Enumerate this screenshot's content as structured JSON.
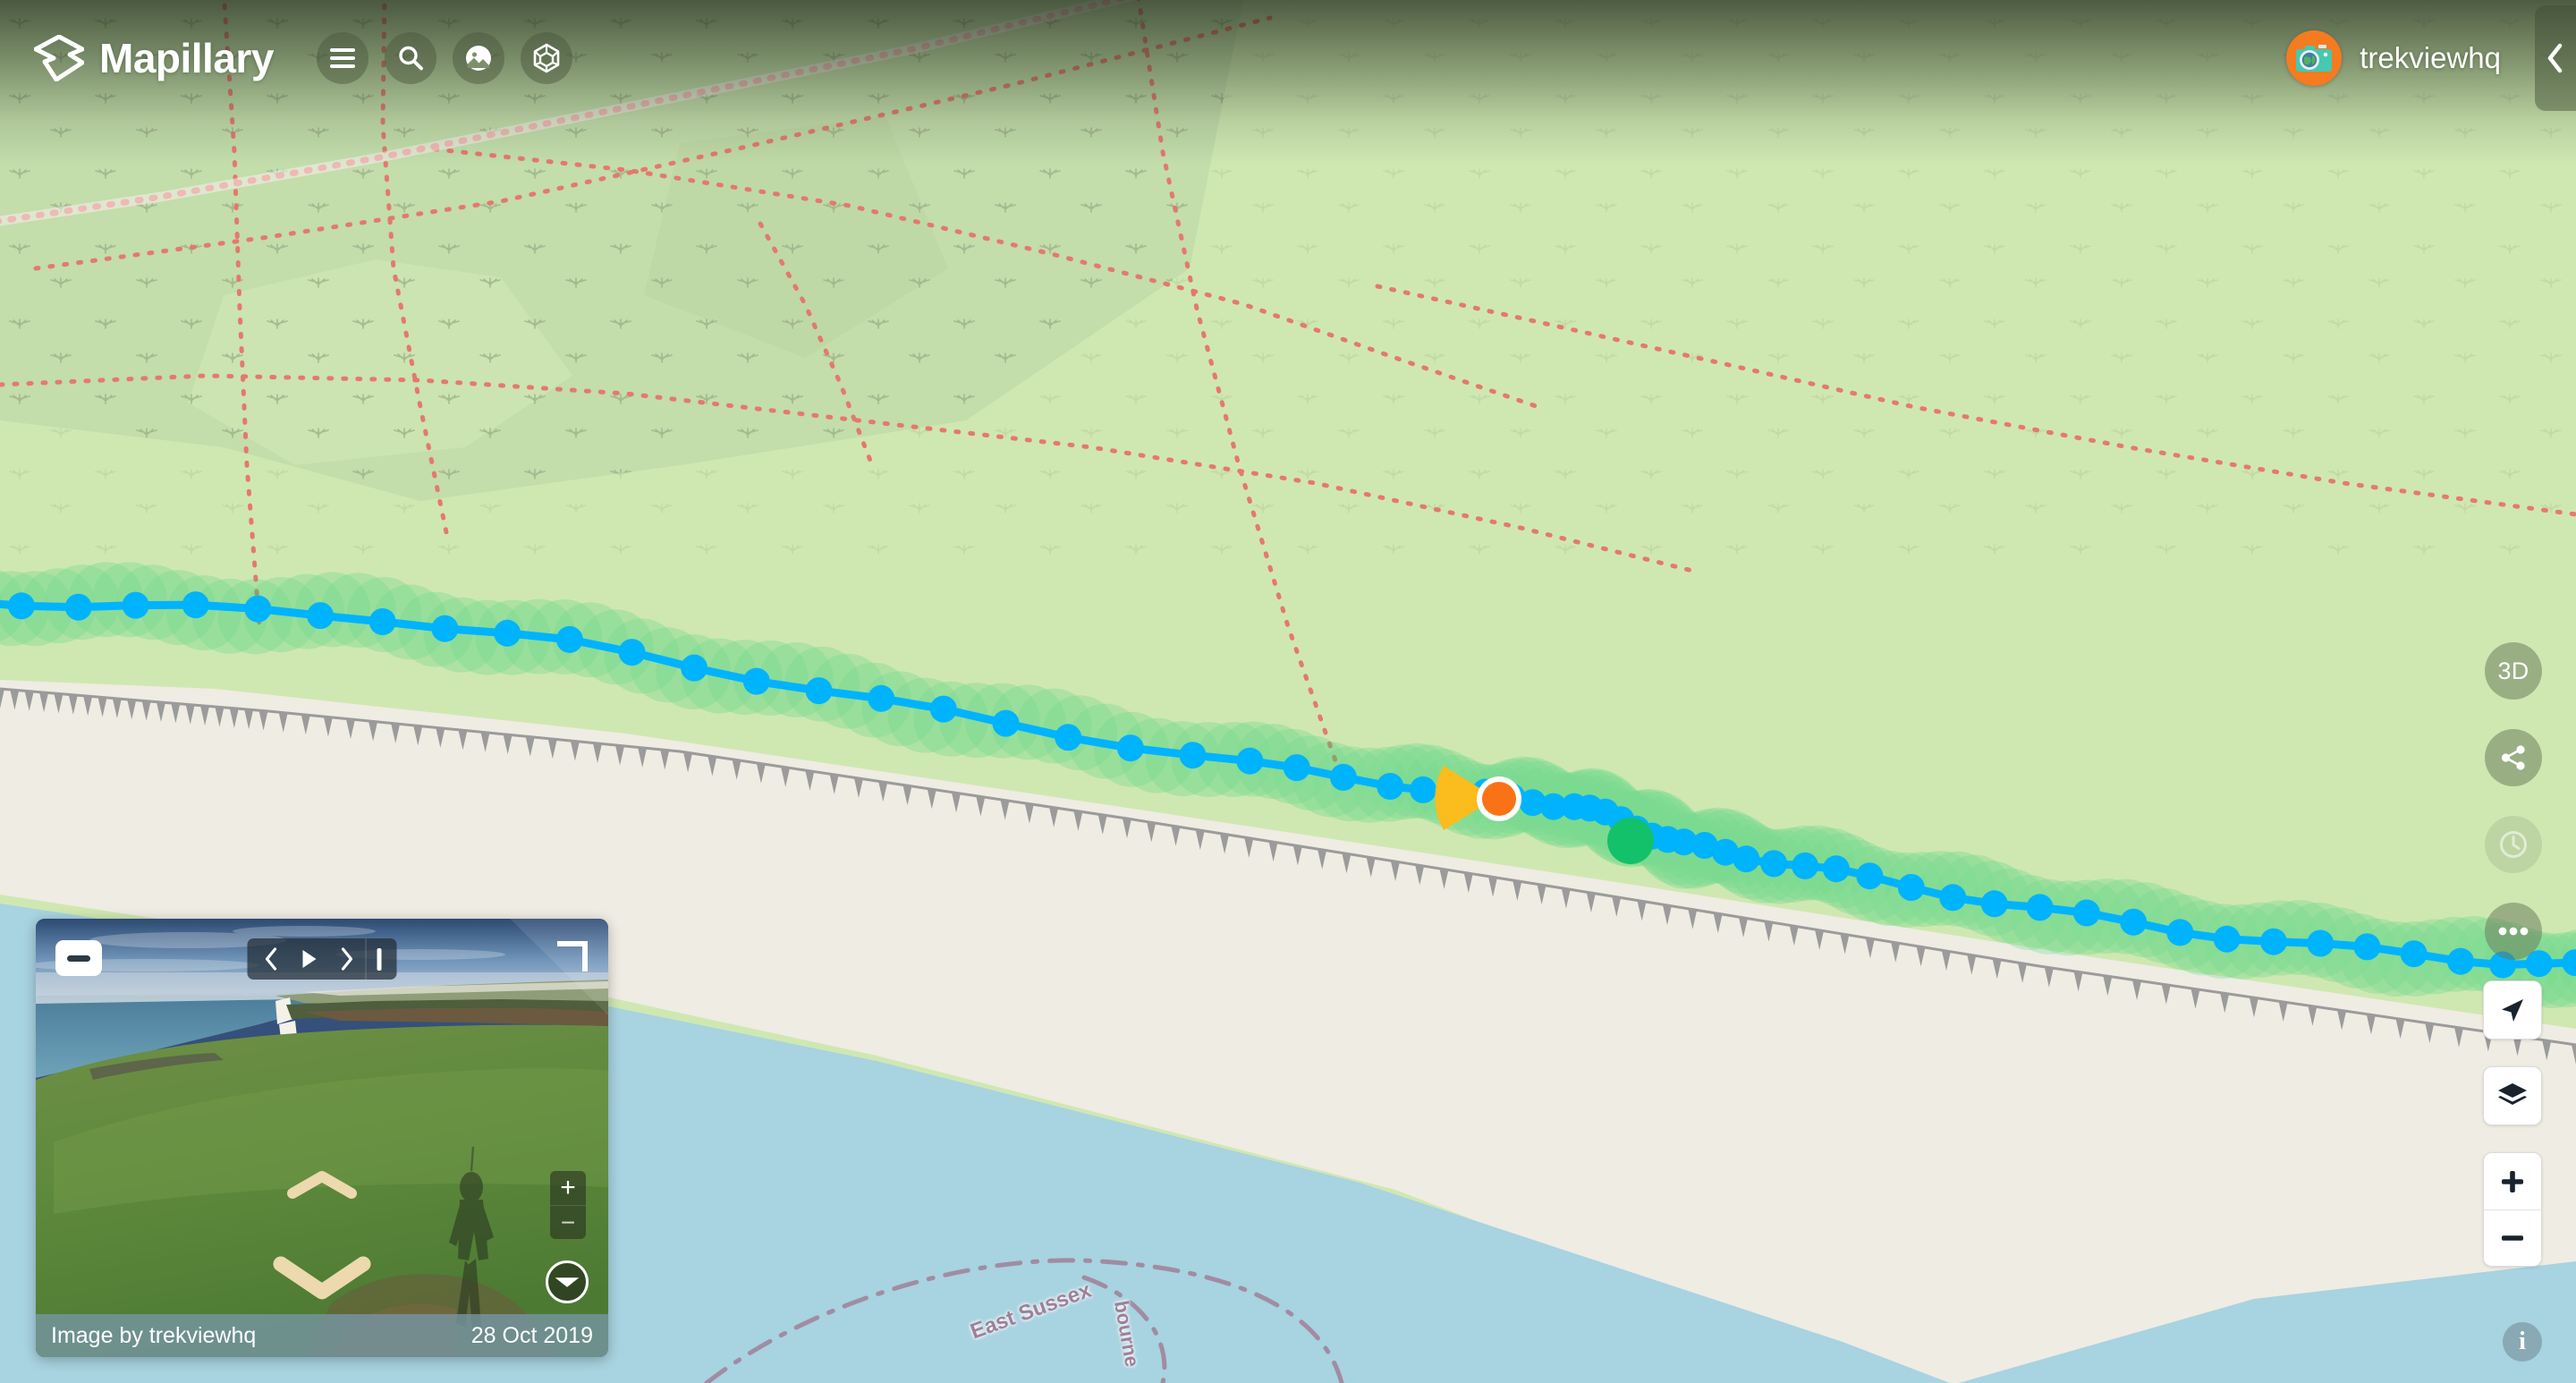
{
  "app": {
    "brand_name": "Mapillary",
    "brand_icon": "mapillary-logo-icon"
  },
  "header": {
    "buttons": [
      {
        "name": "menu-button",
        "icon": "hamburger-menu-icon",
        "label": "Menu"
      },
      {
        "name": "search-button",
        "icon": "search-icon",
        "label": "Search"
      },
      {
        "name": "imagery-button",
        "icon": "photo-icon",
        "label": "Imagery"
      },
      {
        "name": "3d-objects-button",
        "icon": "cube-icon",
        "label": "3D objects"
      }
    ],
    "user": {
      "username": "trekviewhq",
      "avatar_icon": "camera-globe-avatar-icon",
      "avatar_color": "#f47b20"
    },
    "collapse_icon": "chevron-left-icon"
  },
  "right_rail": {
    "items": [
      {
        "name": "3d-toggle-button",
        "label": "3D",
        "icon": "text-3d",
        "enabled": true
      },
      {
        "name": "share-button",
        "label": "",
        "icon": "share-icon",
        "enabled": true
      },
      {
        "name": "history-button",
        "label": "",
        "icon": "clock-icon",
        "enabled": false
      },
      {
        "name": "more-options-button",
        "label": "",
        "icon": "ellipsis-icon",
        "enabled": true
      }
    ]
  },
  "map_controls": {
    "geolocate": {
      "icon": "navigation-arrow-icon",
      "label": "Find my location"
    },
    "layers": {
      "icon": "layers-icon",
      "label": "Map layers"
    },
    "zoom_in": {
      "icon": "plus-icon",
      "label": "Zoom in"
    },
    "zoom_out": {
      "icon": "minus-icon",
      "label": "Zoom out"
    },
    "info": {
      "icon": "info-icon",
      "label": "i"
    }
  },
  "viewer": {
    "minimize_icon": "minimize-icon",
    "expand_icon": "expand-corner-icon",
    "playback": {
      "prev_icon": "chevron-left-icon",
      "play_icon": "play-icon",
      "next_icon": "chevron-right-icon",
      "end_icon": "jump-to-end-icon"
    },
    "nav_up_icon": "chevron-up-icon",
    "nav_down_icon": "chevron-down-icon",
    "zoom_in_label": "+",
    "zoom_out_label": "−",
    "compass_icon": "field-of-view-compass-icon",
    "footer": {
      "attribution": "Image by trekviewhq",
      "date": "28 Oct 2019"
    }
  },
  "map": {
    "labels": [
      {
        "name": "label-east-sussex",
        "text": "East Sussex"
      },
      {
        "name": "label-eastbourne",
        "text": "bourne"
      }
    ],
    "colors": {
      "scrub_green": "#cfe8b2",
      "forest_green": "#c3ddab",
      "water_blue": "#a8d3e0",
      "beach_sand": "#efece3",
      "sequence_green": "#2ecc71",
      "image_blue": "#00b3fd",
      "selected_marker": "#f97316",
      "fov_cone": "#fbbc1e",
      "path_red": "#e8736a",
      "boundary_purple": "#a07f99"
    }
  }
}
